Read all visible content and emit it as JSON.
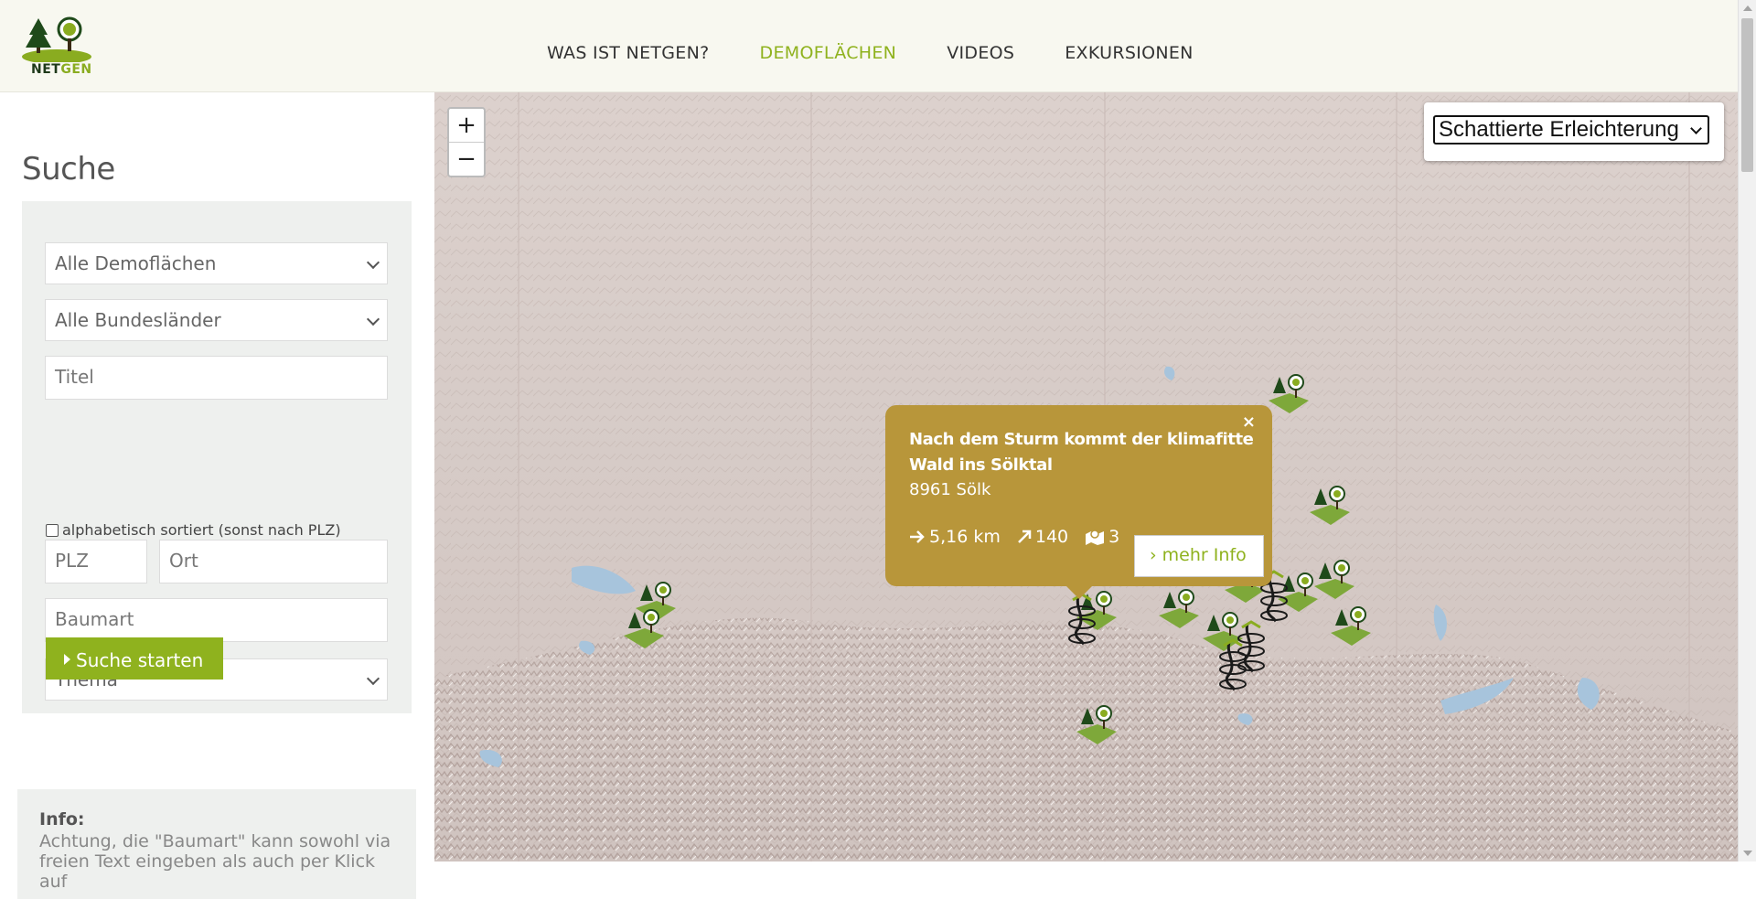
{
  "header": {
    "logo_text_a": "NET",
    "logo_text_b": "GEN",
    "nav": [
      {
        "label": "WAS IST NETGEN?",
        "active": false
      },
      {
        "label": "DEMOFLÄCHEN",
        "active": true
      },
      {
        "label": "VIDEOS",
        "active": false
      },
      {
        "label": "EXKURSIONEN",
        "active": false
      }
    ],
    "colors": {
      "accent": "#8fb21e",
      "background": "#f8f8f0"
    }
  },
  "sidebar": {
    "title": "Suche",
    "filters": {
      "demoflaechen": "Alle Demoflächen",
      "bundeslaender": "Alle Bundesländer",
      "titel_placeholder": "Titel",
      "sort_label": "alphabetisch sortiert (sonst nach PLZ)",
      "sort_checked": false,
      "plz_placeholder": "PLZ",
      "ort_placeholder": "Ort",
      "baumart_placeholder": "Baumart",
      "thema": "Thema"
    },
    "search_button": "Suche starten",
    "info": {
      "heading": "Info:",
      "text": "Achtung, die \"Baumart\" kann sowohl via freien Text eingeben als auch per Klick auf"
    }
  },
  "map": {
    "layer_select": "Schattierte Erleichterung",
    "zoom_in": "+",
    "zoom_out": "−",
    "popup": {
      "title": "Nach dem Sturm kommt der klimafitte Wald ins Sölktal",
      "address": "8961 Sölk",
      "distance": "5,16 km",
      "elevation": "140",
      "count": "3",
      "more_button": "mehr Info",
      "close": "×",
      "color": "#b8963a"
    }
  }
}
